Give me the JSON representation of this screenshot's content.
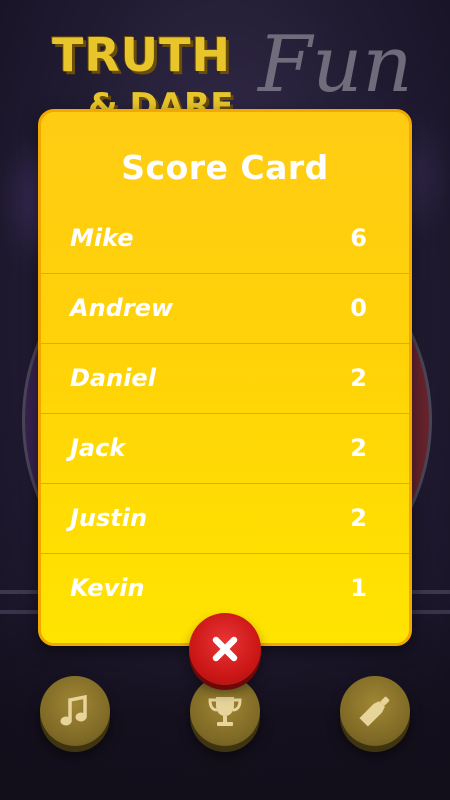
{
  "background": {
    "logo_word_1": "TRUTH",
    "logo_word_2": "& DARE",
    "logo_word_3": "Fun"
  },
  "scorecard": {
    "title": "Score Card",
    "players": [
      {
        "name": "Mike",
        "score": "6"
      },
      {
        "name": "Andrew",
        "score": "0"
      },
      {
        "name": "Daniel",
        "score": "2"
      },
      {
        "name": "Jack",
        "score": "2"
      },
      {
        "name": "Justin",
        "score": "2"
      },
      {
        "name": "Kevin",
        "score": "1"
      }
    ]
  },
  "buttons": {
    "close_icon": "close-icon",
    "music_icon": "music-note-icon",
    "trophy_icon": "trophy-icon",
    "bottle_icon": "bottle-icon"
  },
  "colors": {
    "card_top": "#ffcc14",
    "card_bottom": "#ffe400",
    "card_border": "#f2a800",
    "close_red": "#cc1717",
    "round_button_gold": "#7f6a26",
    "text": "#ffffff"
  }
}
